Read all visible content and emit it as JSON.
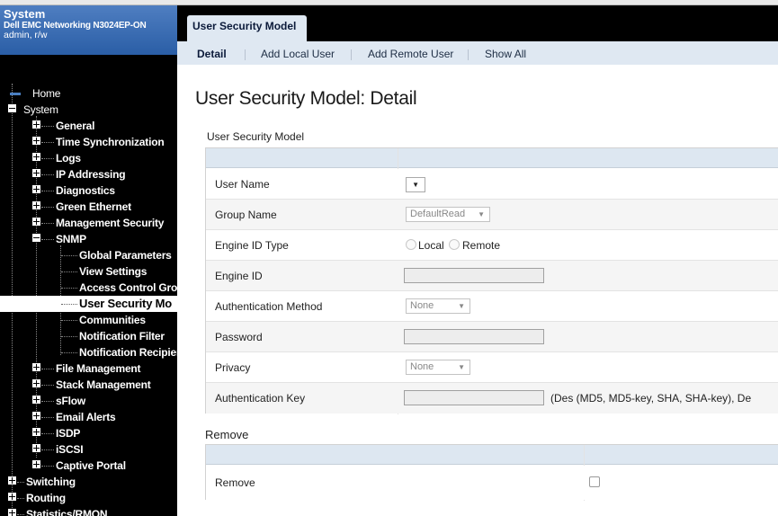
{
  "sidebar": {
    "title": "System",
    "device": "Dell EMC Networking N3024EP-ON",
    "user": "admin, r/w",
    "tree": [
      {
        "label": "Home"
      },
      {
        "label": "System"
      },
      {
        "label": "General"
      },
      {
        "label": "Time Synchronization"
      },
      {
        "label": "Logs"
      },
      {
        "label": "IP Addressing"
      },
      {
        "label": "Diagnostics"
      },
      {
        "label": "Green Ethernet"
      },
      {
        "label": "Management Security"
      },
      {
        "label": "SNMP"
      },
      {
        "label": "Global Parameters"
      },
      {
        "label": "View Settings"
      },
      {
        "label": "Access Control Grou"
      },
      {
        "label": "User Security Mo"
      },
      {
        "label": "Communities"
      },
      {
        "label": "Notification Filter"
      },
      {
        "label": "Notification Recipier"
      },
      {
        "label": "File Management"
      },
      {
        "label": "Stack Management"
      },
      {
        "label": "sFlow"
      },
      {
        "label": "Email Alerts"
      },
      {
        "label": "ISDP"
      },
      {
        "label": "iSCSI"
      },
      {
        "label": "Captive Portal"
      },
      {
        "label": "Switching"
      },
      {
        "label": "Routing"
      },
      {
        "label": "Statistics/RMON"
      }
    ]
  },
  "tab": {
    "label": "User Security Model"
  },
  "subnav": {
    "detail": "Detail",
    "add_local": "Add Local User",
    "add_remote": "Add Remote User",
    "show_all": "Show All"
  },
  "page_title": "User Security Model: Detail",
  "usm": {
    "section_title": "User Security Model",
    "rows": {
      "user_name": {
        "label": "User Name",
        "value": ""
      },
      "group_name": {
        "label": "Group Name",
        "value": "DefaultRead"
      },
      "engine_id_type": {
        "label": "Engine ID Type",
        "option_local": "Local",
        "option_remote": "Remote"
      },
      "engine_id": {
        "label": "Engine ID",
        "value": ""
      },
      "auth_method": {
        "label": "Authentication Method",
        "value": "None"
      },
      "password": {
        "label": "Password",
        "value": ""
      },
      "privacy": {
        "label": "Privacy",
        "value": "None"
      },
      "auth_key": {
        "label": "Authentication Key",
        "value": "",
        "hint": "(Des (MD5, MD5-key, SHA, SHA-key), De"
      }
    }
  },
  "remove": {
    "section_title": "Remove",
    "row_label": "Remove",
    "checked": false
  }
}
